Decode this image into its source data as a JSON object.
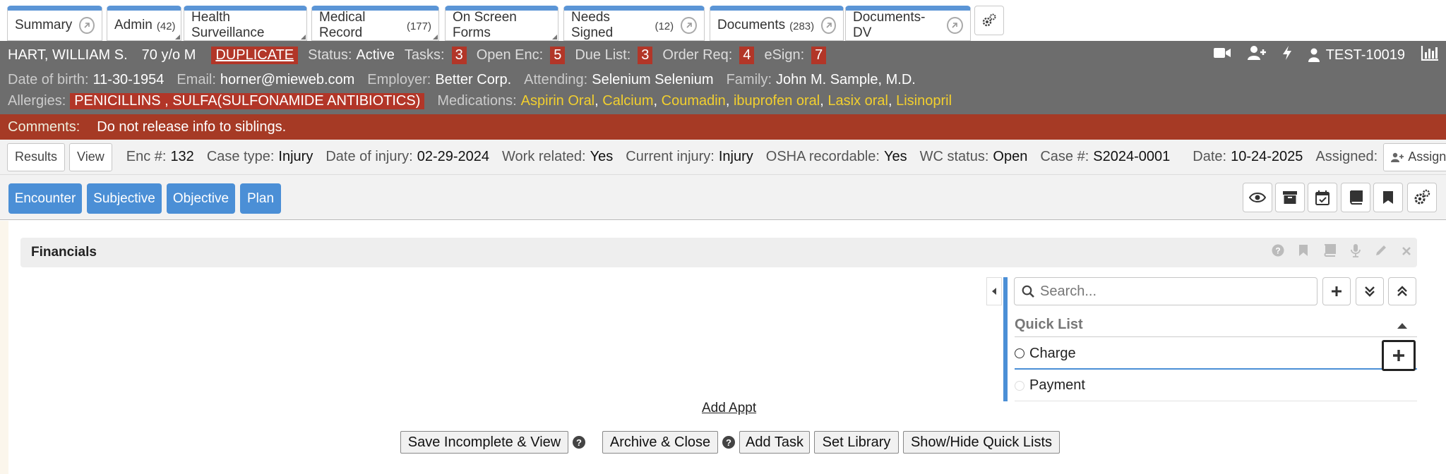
{
  "tabs": [
    {
      "label": "Summary",
      "count": "",
      "popout": true
    },
    {
      "label": "Admin",
      "count": "(42)",
      "popout": false
    },
    {
      "label": "Health Surveillance",
      "count": "",
      "popout": false
    },
    {
      "label": "Medical Record",
      "count": "(177)",
      "popout": false
    },
    {
      "label": "On Screen Forms",
      "count": "",
      "popout": false
    },
    {
      "label": "Needs Signed",
      "count": "(12)",
      "popout": true
    },
    {
      "label": "Documents",
      "count": "(283)",
      "popout": true
    },
    {
      "label": "Documents-DV",
      "count": "",
      "popout": true
    }
  ],
  "patient": {
    "name": "HART, WILLIAM S.",
    "age": "70 y/o M",
    "duplicate": "DUPLICATE",
    "status_label": "Status:",
    "status": "Active",
    "tasks_label": "Tasks:",
    "tasks": "3",
    "open_enc_label": "Open Enc:",
    "open_enc": "5",
    "due_list_label": "Due List:",
    "due_list": "3",
    "order_req_label": "Order Req:",
    "order_req": "4",
    "esign_label": "eSign:",
    "esign": "7",
    "user": "TEST-10019"
  },
  "demographics": {
    "dob_label": "Date of birth:",
    "dob": "11-30-1954",
    "email_label": "Email:",
    "email": "horner@mieweb.com",
    "employer_label": "Employer:",
    "employer": "Better Corp.",
    "attending_label": "Attending:",
    "attending": "Selenium Selenium",
    "family_label": "Family:",
    "family": "John M. Sample, M.D.",
    "allergies_label": "Allergies:",
    "allergies": "PENICILLINS , SULFA(SULFONAMIDE ANTIBIOTICS)",
    "medications_label": "Medications:",
    "medications": [
      "Aspirin Oral",
      "Calcium",
      "Coumadin",
      "ibuprofen oral",
      "Lasix oral",
      "Lisinopril"
    ]
  },
  "comments": {
    "label": "Comments:",
    "text": "Do not release info to siblings."
  },
  "encounter": {
    "results_btn": "Results",
    "view_btn": "View",
    "enc_label": "Enc #:",
    "enc": "132",
    "case_type_label": "Case type:",
    "case_type": "Injury",
    "doi_label": "Date of injury:",
    "doi": "02-29-2024",
    "work_label": "Work related:",
    "work": "Yes",
    "current_label": "Current injury:",
    "current": "Injury",
    "osha_label": "OSHA recordable:",
    "osha": "Yes",
    "wc_label": "WC status:",
    "wc": "Open",
    "case_label": "Case #:",
    "case": "S2024-0001",
    "date_label": "Date:",
    "date": "10-24-2025",
    "assigned_label": "Assigned:",
    "assign_btn": "Assign"
  },
  "sections": [
    "Encounter",
    "Subjective",
    "Objective",
    "Plan"
  ],
  "financials": {
    "title": "Financials",
    "search_placeholder": "Search...",
    "quick_list_title": "Quick List",
    "items": [
      "Charge",
      "Payment"
    ],
    "add_appt": "Add Appt"
  },
  "actions": {
    "save_incomplete": "Save Incomplete & View",
    "archive_close": "Archive & Close",
    "add_task": "Add Task",
    "set_library": "Set Library",
    "show_hide": "Show/Hide Quick Lists"
  },
  "colors": {
    "tab_accent": "#5b95d6",
    "header_gray": "#6d6d6d",
    "alert_red": "#b23628",
    "comments_bg": "#a63a25",
    "med_yellow": "#f2cf2e",
    "primary_blue": "#4b8fd6"
  }
}
